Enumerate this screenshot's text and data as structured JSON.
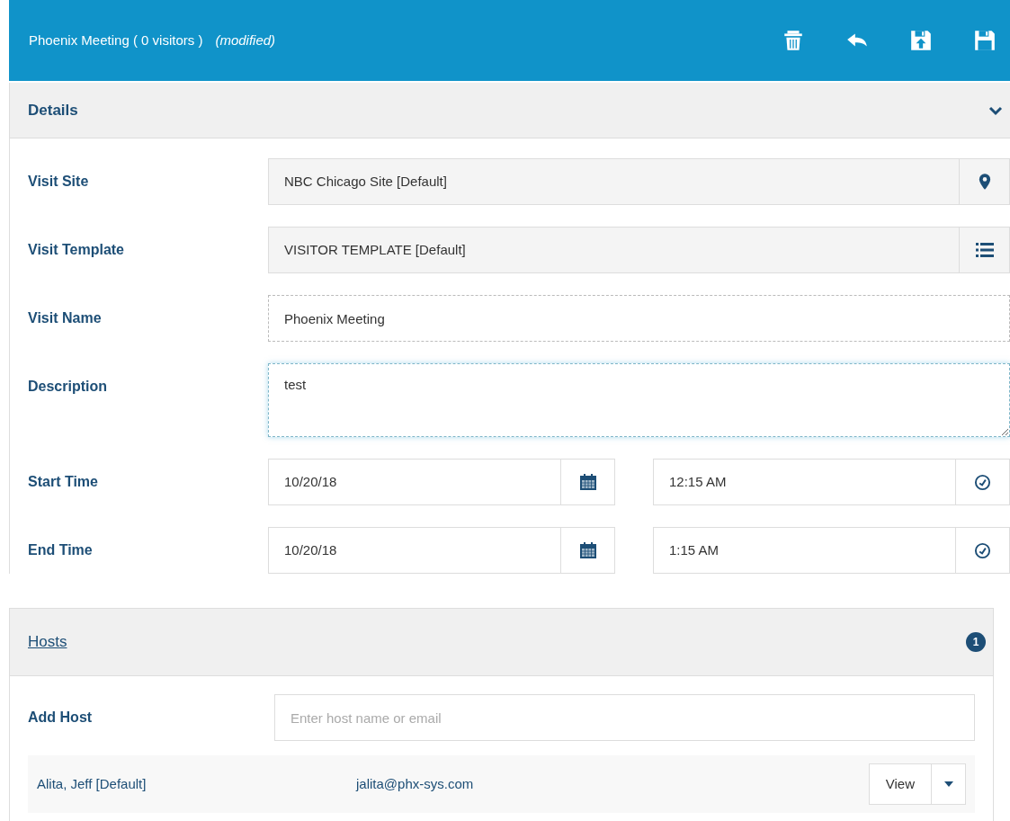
{
  "header": {
    "title": "Phoenix Meeting ( 0 visitors )",
    "status": "(modified)"
  },
  "details": {
    "title": "Details",
    "expanded": true,
    "fields": [
      {
        "kind": "site-picker",
        "label": "Visit Site",
        "value": "NBC Chicago Site  [Default]"
      },
      {
        "kind": "template-picker",
        "label": "Visit Template",
        "value": "VISITOR TEMPLATE  [Default]"
      },
      {
        "kind": "text",
        "label": "Visit Name",
        "value": "Phoenix Meeting",
        "focused": false
      },
      {
        "kind": "textarea",
        "label": "Description",
        "value": "test",
        "focused": true
      },
      {
        "kind": "datetime",
        "label": "Start Time",
        "date": "10/20/18",
        "time": "12:15 AM"
      },
      {
        "kind": "datetime",
        "label": "End Time",
        "date": "10/20/18",
        "time": "1:15 AM"
      }
    ]
  },
  "hosts": {
    "title": "Hosts",
    "count": "1",
    "add_label": "Add Host",
    "placeholder": "Enter host name or email",
    "rows": [
      {
        "name": "Alita, Jeff [Default]",
        "email": "jalita@phx-sys.com",
        "button": "View"
      }
    ]
  }
}
